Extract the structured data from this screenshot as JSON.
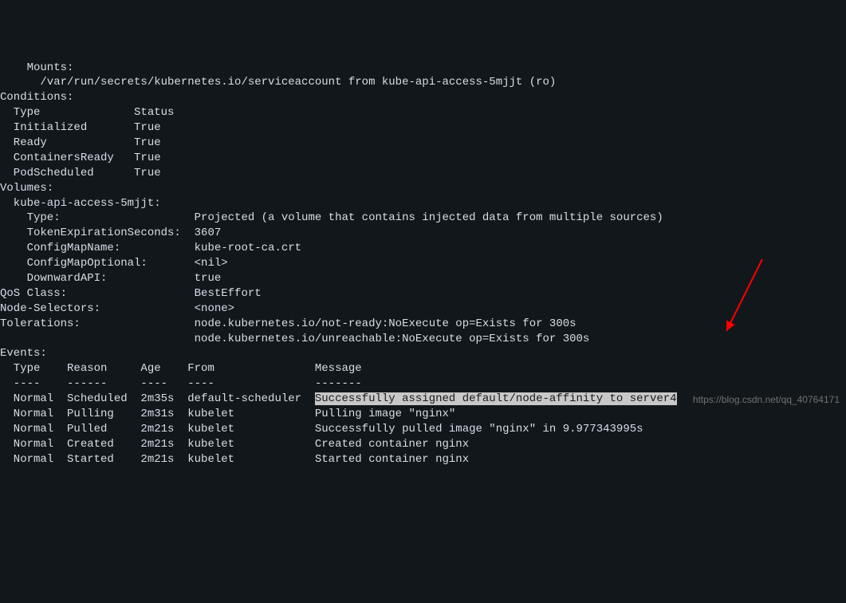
{
  "mounts": {
    "header": "    Mounts:",
    "path": "      /var/run/secrets/kubernetes.io/serviceaccount from kube-api-access-5mjjt (ro)"
  },
  "conditions": {
    "header": "Conditions:",
    "cols": "  Type              Status",
    "rows": [
      "  Initialized       True ",
      "  Ready             True ",
      "  ContainersReady   True ",
      "  PodScheduled      True "
    ]
  },
  "volumes": {
    "header": "Volumes:",
    "name": "  kube-api-access-5mjjt:",
    "rows": [
      "    Type:                    Projected (a volume that contains injected data from multiple sources)",
      "    TokenExpirationSeconds:  3607",
      "    ConfigMapName:           kube-root-ca.crt",
      "    ConfigMapOptional:       <nil>",
      "    DownwardAPI:             true"
    ]
  },
  "qos": "QoS Class:                   BestEffort",
  "nodesel": "Node-Selectors:              <none>",
  "toler1": "Tolerations:                 node.kubernetes.io/not-ready:NoExecute op=Exists for 300s",
  "toler2": "                             node.kubernetes.io/unreachable:NoExecute op=Exists for 300s",
  "events": {
    "header": "Events:",
    "cols": "  Type    Reason     Age    From               Message",
    "dash": "  ----    ------     ----   ----               -------",
    "row0a": "  Normal  Scheduled  2m35s  default-scheduler  ",
    "row0b": "Successfully assigned default/node-affinity to server4",
    "row1": "  Normal  Pulling    2m31s  kubelet            Pulling image \"nginx\"",
    "row2": "  Normal  Pulled     2m21s  kubelet            Successfully pulled image \"nginx\" in 9.977343995s",
    "row3": "  Normal  Created    2m21s  kubelet            Created container nginx",
    "row4": "  Normal  Started    2m21s  kubelet            Started container nginx"
  },
  "watermark": "https://blog.csdn.net/qq_40764171"
}
